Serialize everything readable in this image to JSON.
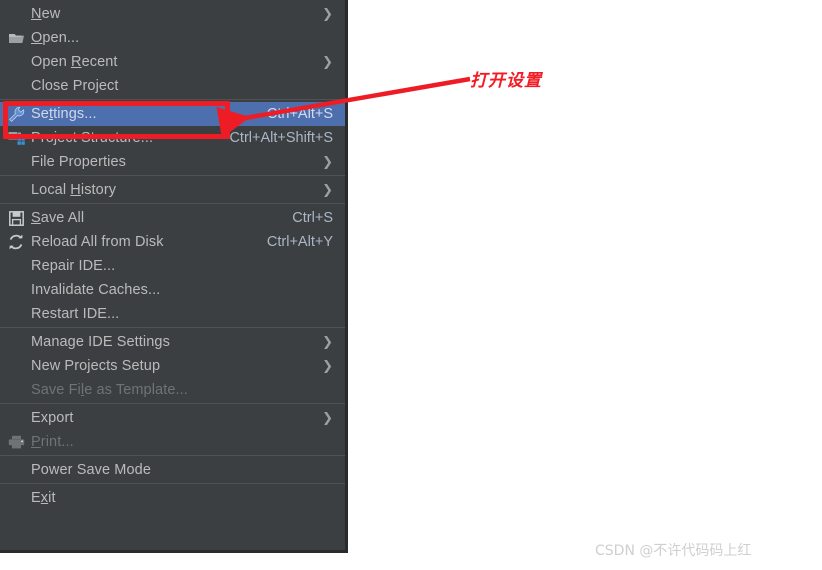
{
  "menu": {
    "groups": [
      {
        "items": [
          {
            "label": "New",
            "mnemonic": "N",
            "icon": "none",
            "accel": "",
            "submenu": true,
            "state": "normal"
          },
          {
            "label": "Open...",
            "mnemonic": "O",
            "icon": "folder-icon",
            "accel": "",
            "submenu": false,
            "state": "normal"
          },
          {
            "label": "Open Recent",
            "mnemonic": "R",
            "icon": "none",
            "accel": "",
            "submenu": true,
            "state": "normal"
          },
          {
            "label": "Close Project",
            "mnemonic": "",
            "icon": "none",
            "accel": "",
            "submenu": false,
            "state": "normal"
          }
        ]
      },
      {
        "items": [
          {
            "label": "Settings...",
            "mnemonic": "t",
            "icon": "wrench-icon",
            "accel": "Ctrl+Alt+S",
            "submenu": false,
            "state": "selected"
          },
          {
            "label": "Project Structure...",
            "mnemonic": "",
            "icon": "project-structure-icon",
            "accel": "Ctrl+Alt+Shift+S",
            "submenu": false,
            "state": "normal"
          },
          {
            "label": "File Properties",
            "mnemonic": "",
            "icon": "none",
            "accel": "",
            "submenu": true,
            "state": "normal"
          }
        ]
      },
      {
        "items": [
          {
            "label": "Local History",
            "mnemonic": "H",
            "icon": "none",
            "accel": "",
            "submenu": true,
            "state": "normal"
          }
        ]
      },
      {
        "items": [
          {
            "label": "Save All",
            "mnemonic": "S",
            "icon": "save-icon",
            "accel": "Ctrl+S",
            "submenu": false,
            "state": "normal"
          },
          {
            "label": "Reload All from Disk",
            "mnemonic": "",
            "icon": "reload-icon",
            "accel": "Ctrl+Alt+Y",
            "submenu": false,
            "state": "normal"
          },
          {
            "label": "Repair IDE...",
            "mnemonic": "",
            "icon": "none",
            "accel": "",
            "submenu": false,
            "state": "normal"
          },
          {
            "label": "Invalidate Caches...",
            "mnemonic": "",
            "icon": "none",
            "accel": "",
            "submenu": false,
            "state": "normal"
          },
          {
            "label": "Restart IDE...",
            "mnemonic": "",
            "icon": "none",
            "accel": "",
            "submenu": false,
            "state": "normal"
          }
        ]
      },
      {
        "items": [
          {
            "label": "Manage IDE Settings",
            "mnemonic": "",
            "icon": "none",
            "accel": "",
            "submenu": true,
            "state": "normal"
          },
          {
            "label": "New Projects Setup",
            "mnemonic": "",
            "icon": "none",
            "accel": "",
            "submenu": true,
            "state": "normal"
          },
          {
            "label": "Save File as Template...",
            "mnemonic": "l",
            "icon": "none",
            "accel": "",
            "submenu": false,
            "state": "disabled"
          }
        ]
      },
      {
        "items": [
          {
            "label": "Export",
            "mnemonic": "",
            "icon": "none",
            "accel": "",
            "submenu": true,
            "state": "normal"
          },
          {
            "label": "Print...",
            "mnemonic": "P",
            "icon": "printer-icon",
            "accel": "",
            "submenu": false,
            "state": "disabled"
          }
        ]
      },
      {
        "items": [
          {
            "label": "Power Save Mode",
            "mnemonic": "",
            "icon": "none",
            "accel": "",
            "submenu": false,
            "state": "normal"
          }
        ]
      },
      {
        "items": [
          {
            "label": "Exit",
            "mnemonic": "x",
            "icon": "none",
            "accel": "",
            "submenu": false,
            "state": "normal"
          }
        ]
      }
    ]
  },
  "annotation": {
    "text": "打开设置",
    "color": "#f41c24",
    "highlight_target": "Settings...",
    "highlight_color": "#ee1c25"
  },
  "watermark": {
    "text": "CSDN @不许代码码上红"
  },
  "colors": {
    "menu_background": "#3c3f41",
    "menu_border": "#2b2b2b",
    "separator": "#4f5355",
    "text": "#bbbbbb",
    "text_disabled": "#6f7376",
    "accel_text": "#a9b7c6",
    "selection_blue": "#4e6fae"
  }
}
